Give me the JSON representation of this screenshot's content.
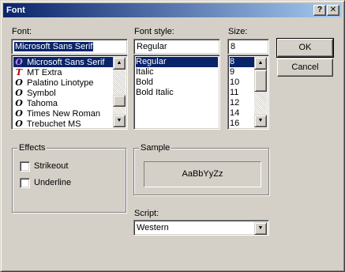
{
  "window": {
    "title": "Font",
    "help_button": "?",
    "close_button": "✕"
  },
  "font": {
    "label": "Font:",
    "value": "Microsoft Sans Serif",
    "items": [
      {
        "name": "Microsoft Sans Serif",
        "icon": "O",
        "icon_name": "opentype-font-icon",
        "selected": true
      },
      {
        "name": "MT Extra",
        "icon": "T",
        "icon_name": "truetype-font-icon",
        "selected": false
      },
      {
        "name": "Palatino Linotype",
        "icon": "O",
        "icon_name": "opentype-font-icon",
        "selected": false
      },
      {
        "name": "Symbol",
        "icon": "O",
        "icon_name": "opentype-font-icon",
        "selected": false
      },
      {
        "name": "Tahoma",
        "icon": "O",
        "icon_name": "opentype-font-icon",
        "selected": false
      },
      {
        "name": "Times New Roman",
        "icon": "O",
        "icon_name": "opentype-font-icon",
        "selected": false
      },
      {
        "name": "Trebuchet MS",
        "icon": "O",
        "icon_name": "opentype-font-icon",
        "selected": false
      }
    ]
  },
  "style": {
    "label": "Font style:",
    "value": "Regular",
    "items": [
      {
        "name": "Regular",
        "selected": true
      },
      {
        "name": "Italic",
        "selected": false
      },
      {
        "name": "Bold",
        "selected": false
      },
      {
        "name": "Bold Italic",
        "selected": false
      }
    ]
  },
  "size": {
    "label": "Size:",
    "value": "8",
    "items": [
      {
        "name": "8",
        "selected": true
      },
      {
        "name": "9",
        "selected": false
      },
      {
        "name": "10",
        "selected": false
      },
      {
        "name": "11",
        "selected": false
      },
      {
        "name": "12",
        "selected": false
      },
      {
        "name": "14",
        "selected": false
      },
      {
        "name": "16",
        "selected": false
      }
    ]
  },
  "buttons": {
    "ok": "OK",
    "cancel": "Cancel"
  },
  "effects": {
    "title": "Effects",
    "strikeout": "Strikeout",
    "underline": "Underline"
  },
  "sample": {
    "title": "Sample",
    "text": "AaBbYyZz"
  },
  "script": {
    "label": "Script:",
    "value": "Western"
  },
  "colors": {
    "face": "#d4d0c8",
    "selection": "#0a246a",
    "titlebar_start": "#0a246a",
    "titlebar_end": "#a6caf0"
  }
}
